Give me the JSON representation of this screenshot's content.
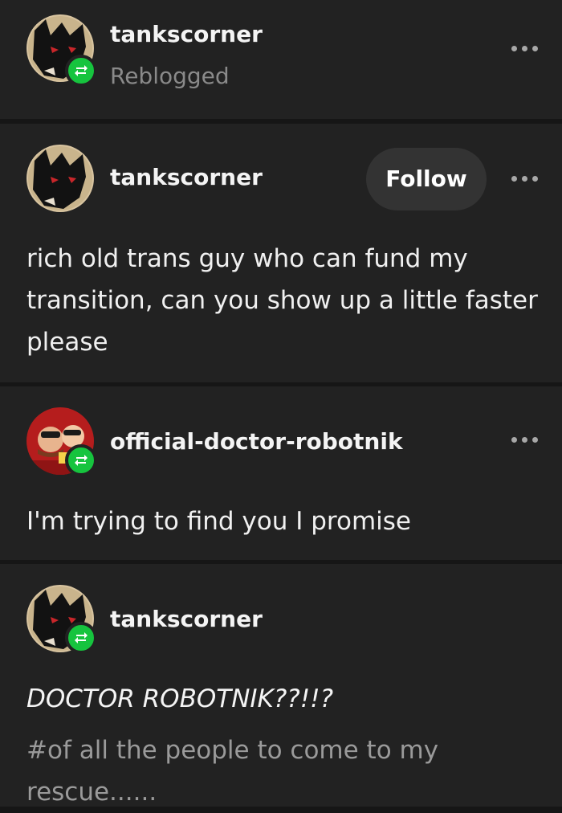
{
  "post_header": {
    "username": "tankscorner",
    "status": "Reblogged"
  },
  "thread": [
    {
      "username": "tankscorner",
      "follow_label": "Follow",
      "text": "rich old trans guy who can fund my transition, can you show up a little faster please"
    },
    {
      "username": "official-doctor-robotnik",
      "text": "I'm trying to find you I promise"
    },
    {
      "username": "tankscorner",
      "text": "DOCTOR ROBOTNIK??!!?",
      "tags": "#of all the people to come to my rescue......"
    }
  ],
  "icons": {
    "more": "more-options-icon",
    "reblog": "reblog-icon"
  },
  "colors": {
    "background": "#222222",
    "separator": "#161616",
    "reblog_badge": "#16c43e",
    "follow_button": "#333333",
    "muted_text": "#8a8a8a"
  }
}
